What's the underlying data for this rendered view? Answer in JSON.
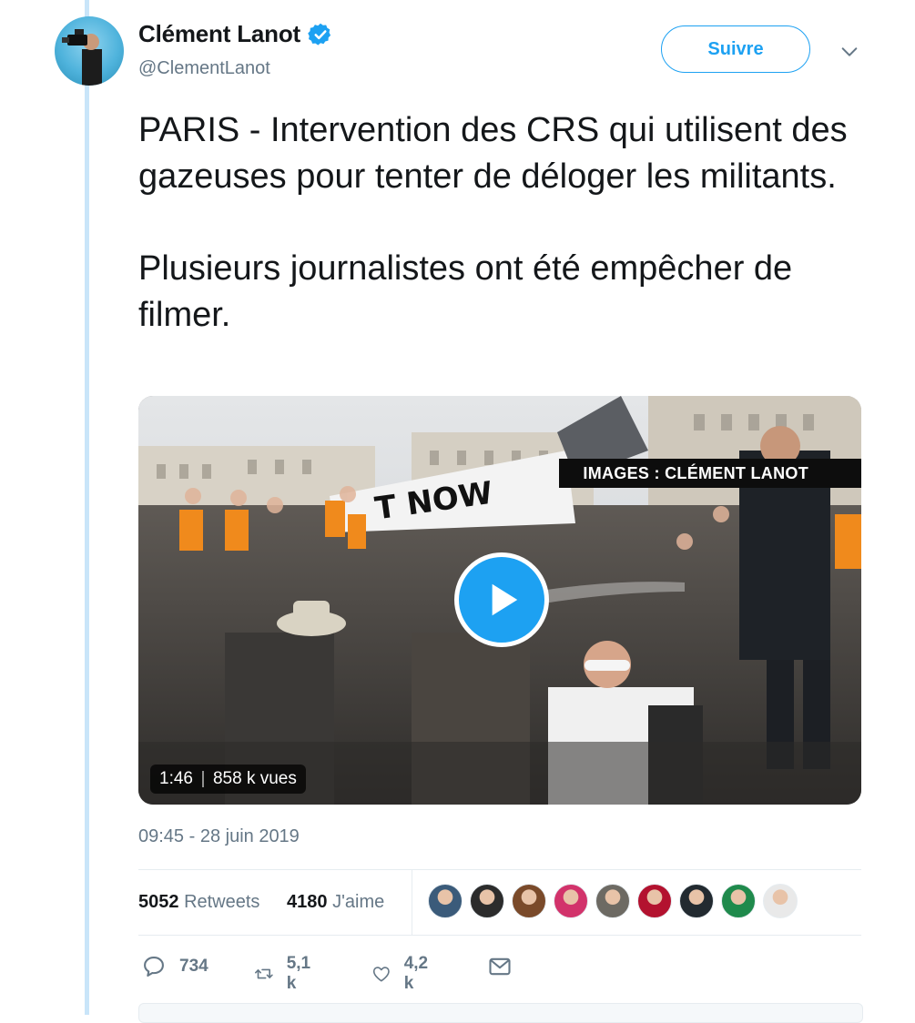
{
  "author": {
    "name": "Clément Lanot",
    "handle": "@ClementLanot",
    "verified": true,
    "avatar_icon": "avatar-cameraman"
  },
  "follow_label": "Suivre",
  "menu_icon": "chevron-down-icon",
  "tweet": {
    "paragraph1": "PARIS - Intervention des CRS qui utilisent des gazeuses pour tenter de déloger les militants.",
    "paragraph2": "Plusieurs journalistes ont été empêcher de filmer."
  },
  "video": {
    "watermark": "IMAGES : CLÉMENT LANOT",
    "duration": "1:46",
    "views": "858 k vues",
    "play_icon": "play-icon"
  },
  "timestamp": "09:45 - 28 juin 2019",
  "stats": {
    "retweets_count": "5052",
    "retweets_label": "Retweets",
    "likes_count": "4180",
    "likes_label": "J'aime"
  },
  "likers": [
    {
      "color": "#3b5b7a"
    },
    {
      "color": "#2c2c2c"
    },
    {
      "color": "#7a4a2a"
    },
    {
      "color": "#d2336b"
    },
    {
      "color": "#6d6a63"
    },
    {
      "color": "#b3122f"
    },
    {
      "color": "#222a30"
    },
    {
      "color": "#1f8a4c"
    },
    {
      "color": "#e9e9e9"
    }
  ],
  "actions": {
    "reply_count": "734",
    "retweet_count": "5,1 k",
    "like_count": "4,2 k"
  },
  "colors": {
    "accent": "#1da1f2",
    "muted_text": "#657786",
    "thread_line": "#c9e5f9"
  }
}
